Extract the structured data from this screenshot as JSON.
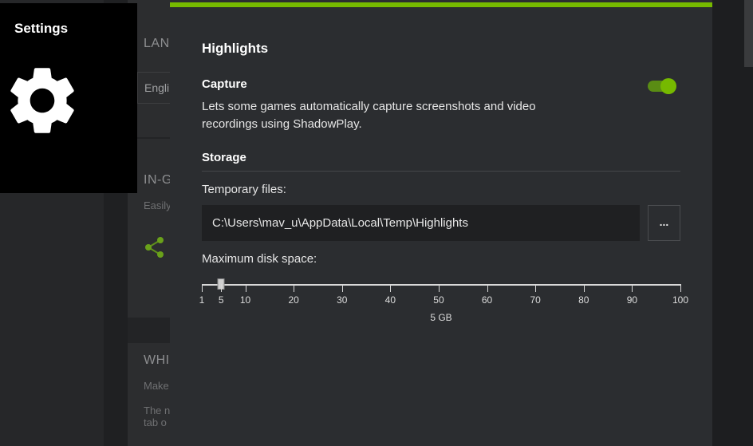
{
  "background_page": {
    "language_heading": "LAN",
    "language_value": "Engli",
    "ingame_heading": "IN-G",
    "ingame_desc": "Easily",
    "share_icon": "share-icon",
    "whisper_heading": "WHI",
    "whisper_desc": "Make",
    "whisper_note_line1": "The n",
    "whisper_note_line2": "tab o"
  },
  "settings": {
    "title": "Settings",
    "icon": "gear-icon"
  },
  "dialog": {
    "title": "Highlights",
    "accent_color": "#76b900",
    "capture": {
      "title": "Capture",
      "description": "Lets some games automatically capture screenshots and video recordings using ShadowPlay.",
      "enabled": true
    },
    "storage": {
      "title": "Storage",
      "temp_files_label": "Temporary files:",
      "temp_files_path": "C:\\Users\\mav_u\\AppData\\Local\\Temp\\Highlights",
      "browse_label": "...",
      "max_disk_label": "Maximum disk space:",
      "slider": {
        "min": 1,
        "max": 100,
        "value": 5,
        "ticks": [
          1,
          5,
          10,
          20,
          30,
          40,
          50,
          60,
          70,
          80,
          90,
          100
        ],
        "value_label": "5 GB"
      }
    }
  }
}
